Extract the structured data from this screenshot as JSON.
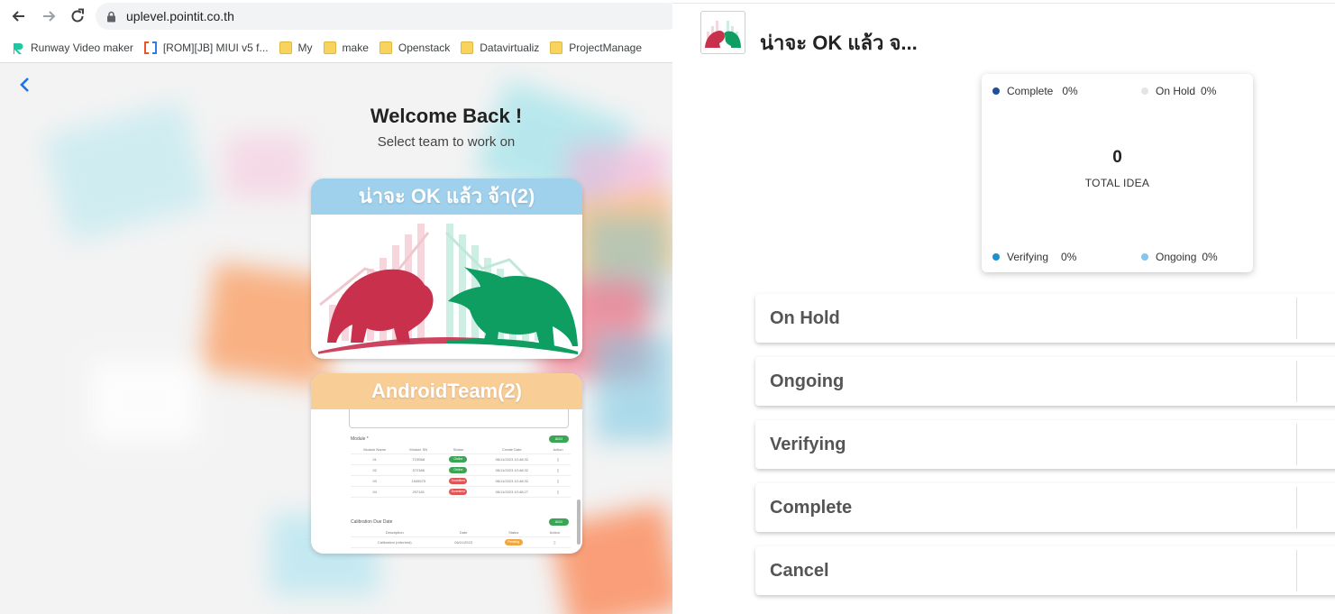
{
  "browser": {
    "url": "uplevel.pointit.co.th",
    "bookmarks": [
      {
        "label": "Runway Video maker",
        "icon": "runway-icon"
      },
      {
        "label": "[ROM][JB] MIUI v5 f...",
        "icon": "xda-icon"
      },
      {
        "label": "My",
        "icon": "folder-icon"
      },
      {
        "label": "make",
        "icon": "folder-icon"
      },
      {
        "label": "Openstack",
        "icon": "folder-icon"
      },
      {
        "label": "Datavirtualiz",
        "icon": "folder-icon"
      },
      {
        "label": "ProjectManage",
        "icon": "folder-icon"
      }
    ]
  },
  "welcome": {
    "title": "Welcome Back !",
    "subtitle": "Select team to work on"
  },
  "teams": [
    {
      "name": "น่าจะ OK แล้ว จ้า(2)",
      "color": "#9fd0ec"
    },
    {
      "name": "AndroidTeam(2)",
      "color": "#f9cd96"
    }
  ],
  "mini_screenshot": {
    "module_label": "Module *",
    "add_label": "ADD",
    "columns": [
      "Module Name",
      "Module SN",
      "Status",
      "Create Date",
      "Action"
    ],
    "rows": [
      {
        "name": "01",
        "sn": "T23568",
        "status": "Online",
        "date": "06/11/2023 10:48:32",
        "status_color": "g"
      },
      {
        "name": "02",
        "sn": "572386",
        "status": "Online",
        "date": "06/11/2023 10:48:32",
        "status_color": "g"
      },
      {
        "name": "03",
        "sn": "1545575",
        "status": "Downtime",
        "date": "06/11/2023 10:48:32",
        "status_color": "r"
      },
      {
        "name": "04",
        "sn": "297181",
        "status": "Downtime",
        "date": "06/11/2023 10:48:27",
        "status_color": "r"
      }
    ],
    "calib_label": "Calibration Due Date",
    "calib_columns": [
      "Description",
      "Date",
      "Status",
      "Action"
    ],
    "calib_row": {
      "desc": "Calibration (refurbed)",
      "date": "06/11/2023",
      "status": "Pending"
    }
  },
  "app": {
    "team_title": "น่าจะ OK แล้ว จ...",
    "summary": {
      "total": "0",
      "total_label": "TOTAL IDEA",
      "legend": [
        {
          "label": "Complete",
          "pct": "0%",
          "color": "#1f4e9c"
        },
        {
          "label": "On Hold",
          "pct": "0%",
          "color": "#e4e4e4"
        },
        {
          "label": "Verifying",
          "pct": "0%",
          "color": "#1e8fcf"
        },
        {
          "label": "Ongoing",
          "pct": "0%",
          "color": "#86c6ec"
        }
      ]
    },
    "statuses": [
      "On Hold",
      "Ongoing",
      "Verifying",
      "Complete",
      "Cancel"
    ]
  }
}
